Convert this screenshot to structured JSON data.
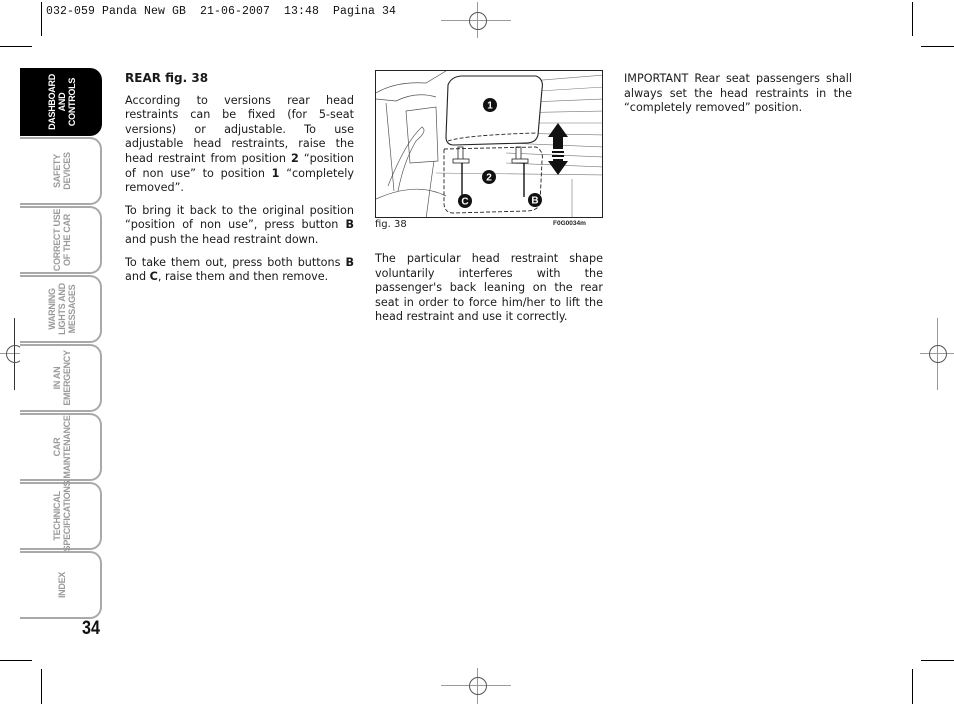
{
  "header": {
    "slug": "032-059 Panda New GB  21-06-2007  13:48  Pagina 34"
  },
  "sidebar": {
    "tabs": [
      {
        "label": "DASHBOARD\nAND CONTROLS",
        "active": true
      },
      {
        "label": "SAFETY\nDEVICES",
        "active": false
      },
      {
        "label": "CORRECT USE\nOF THE CAR",
        "active": false
      },
      {
        "label": "WARNING\nLIGHTS AND\nMESSAGES",
        "active": false
      },
      {
        "label": "IN AN\nEMERGENCY",
        "active": false
      },
      {
        "label": "CAR\nMAINTENANCE",
        "active": false
      },
      {
        "label": "TECHNICAL\nSPECIFICATIONS",
        "active": false
      },
      {
        "label": "INDEX",
        "active": false
      }
    ],
    "page_number": "34"
  },
  "column1": {
    "heading": "REAR fig. 38",
    "p1_a": "According to versions rear head restraints can be fixed (for 5-seat versions) or adjustable. To use adjustable head restraints, raise the head restraint from position ",
    "p1_b": "2",
    "p1_c": " “position of non use” to position ",
    "p1_d": "1",
    "p1_e": " “completely removed”.",
    "p2_a": "To bring it back to the original position “position of non use”, press button ",
    "p2_b": "B",
    "p2_c": " and push the head restraint down.",
    "p3_a": "To take them out, press both buttons ",
    "p3_b": "B",
    "p3_c": " and ",
    "p3_d": "C",
    "p3_e": ", raise them and then remove."
  },
  "figure": {
    "caption": "fig. 38",
    "code": "F0G0034m",
    "labels": {
      "pos1": "1",
      "pos2": "2",
      "btnC": "C",
      "btnB": "B"
    }
  },
  "column2": {
    "text": "The particular head restraint shape voluntarily interferes with the passenger's back leaning on the rear seat in order to force him/her to lift the head restraint and use it correctly."
  },
  "column3": {
    "text": "IMPORTANT Rear seat passengers shall always set the head restraints in the “completely removed” position."
  }
}
